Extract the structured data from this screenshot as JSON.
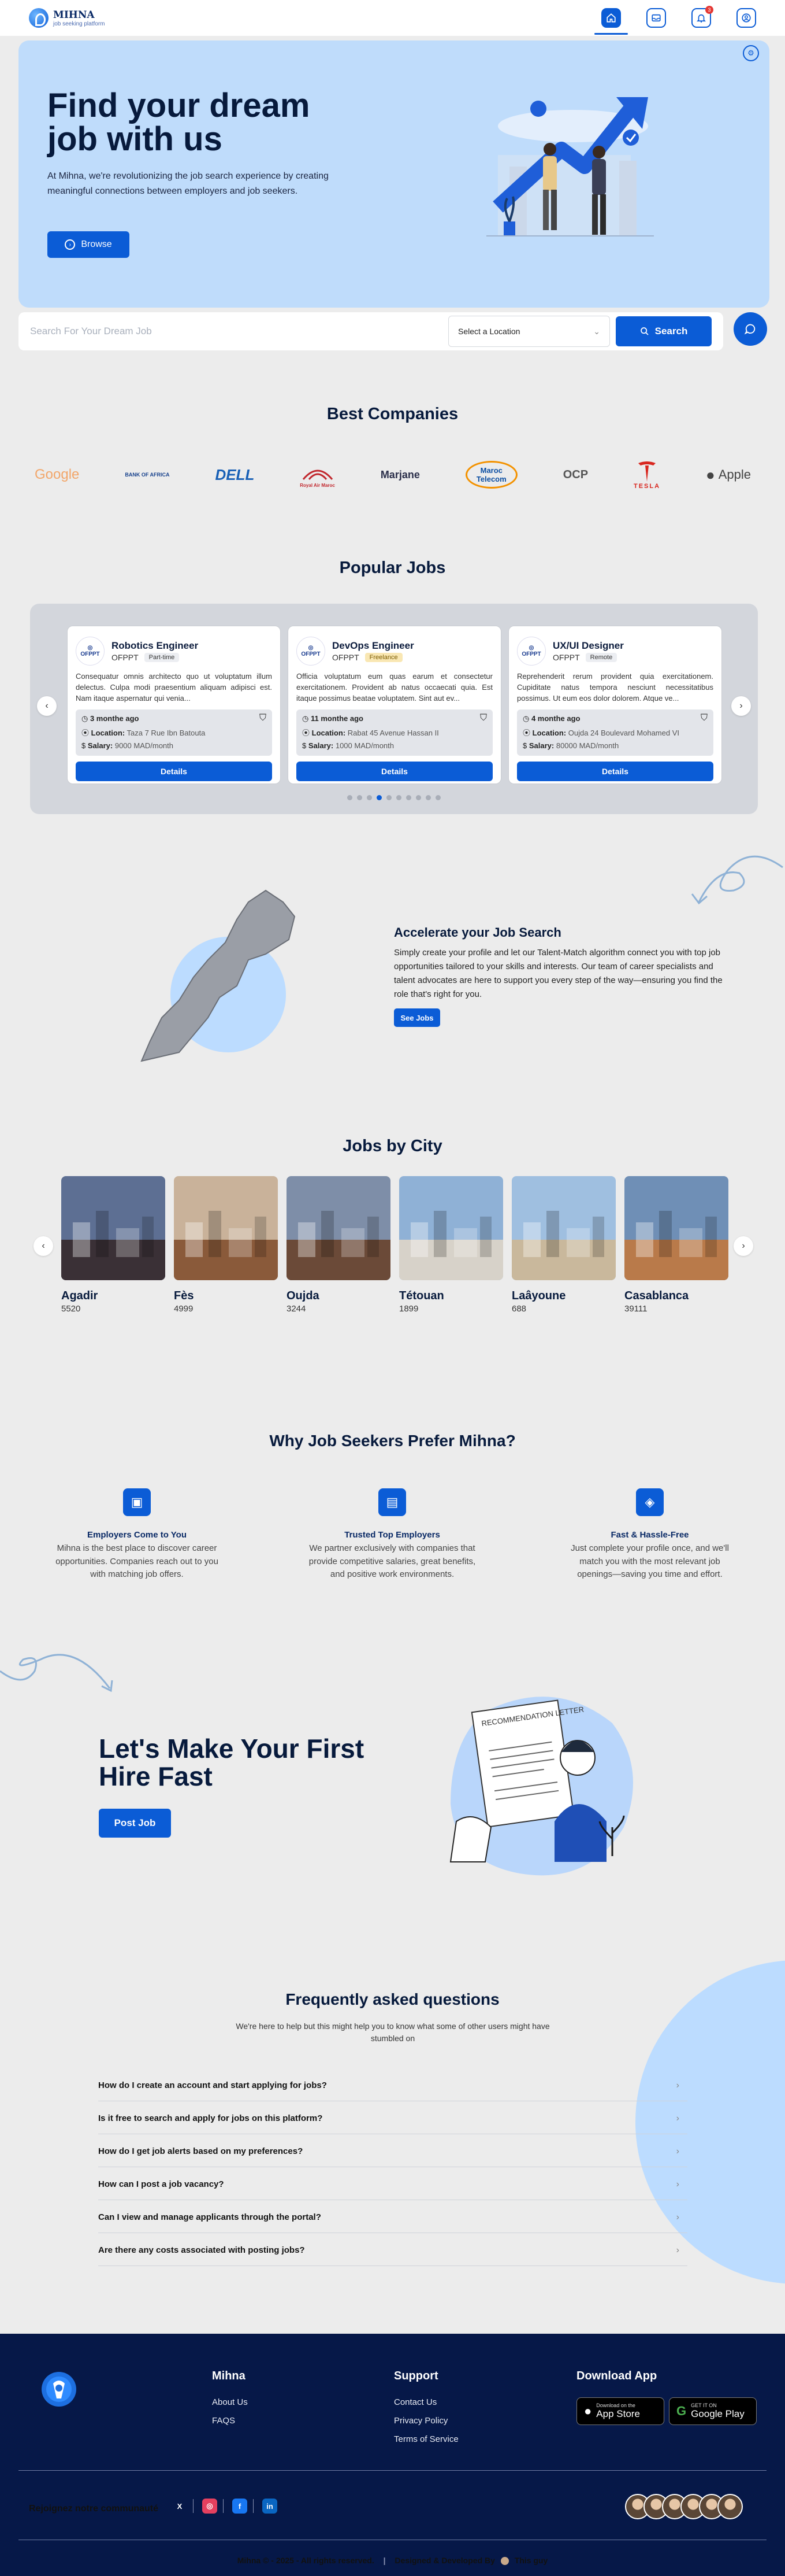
{
  "header": {
    "logo_name": "MIHNA",
    "logo_tagline": "job seeking platform",
    "notification_count": "3"
  },
  "hero": {
    "title": "Find your dream job with us",
    "description": "At Mihna, we're revolutionizing the job search experience by creating meaningful connections between employers and job seekers.",
    "browse_label": "Browse"
  },
  "search": {
    "placeholder": "Search For Your Dream Job",
    "location_label": "Select a Location",
    "button_label": "Search"
  },
  "companies": {
    "title": "Best Companies",
    "items": [
      "Google",
      "Bank of Africa",
      "DELL",
      "Royal Air Maroc",
      "Marjane",
      "Maroc Telecom",
      "OCP",
      "TESLA",
      "Apple"
    ]
  },
  "jobs": {
    "title": "Popular Jobs",
    "location_label": "Location:",
    "salary_label": "Salary:",
    "details_label": "Details",
    "cards": [
      {
        "title": "Robotics Engineer",
        "company": "OFPPT",
        "type": "Part-time",
        "description": "Consequatur omnis architecto quo ut voluptatum illum delectus. Culpa modi praesentium aliquam adipisci est. Nam itaque aspernatur qui venia...",
        "posted": "3 monthe ago",
        "location": "Taza 7 Rue Ibn Batouta",
        "salary": "9000 MAD/month"
      },
      {
        "title": "DevOps Engineer",
        "company": "OFPPT",
        "type": "Freelance",
        "description": "Officia voluptatum eum quas earum et consectetur exercitationem. Provident ab natus occaecati quia. Est itaque possimus beatae voluptatem. Sint aut ev...",
        "posted": "11 monthe ago",
        "location": "Rabat 45 Avenue Hassan II",
        "salary": "1000 MAD/month"
      },
      {
        "title": "UX/UI Designer",
        "company": "OFPPT",
        "type": "Remote",
        "description": "Reprehenderit rerum provident quia exercitationem. Cupiditate natus tempora nesciunt necessitatibus possimus. Ut eum eos dolor dolorem. Atque ve...",
        "posted": "4 monthe ago",
        "location": "Oujda 24 Boulevard Mohamed VI",
        "salary": "80000 MAD/month"
      }
    ],
    "active_dot": 3,
    "dot_count": 10
  },
  "accelerate": {
    "title": "Accelerate your Job Search",
    "text": "Simply create your profile and let our Talent-Match algorithm connect you with top job opportunities tailored to your skills and interests. Our team of career specialists and talent advocates are here to support you every step of the way—ensuring you find the role that's right for you.",
    "button_label": "See Jobs"
  },
  "cities": {
    "title": "Jobs by City",
    "items": [
      {
        "name": "Agadir",
        "count": "5520",
        "sky": "#5d6f93",
        "ground": "#3a3036"
      },
      {
        "name": "Fès",
        "count": "4999",
        "sky": "#c9b29a",
        "ground": "#8a5a3a"
      },
      {
        "name": "Oujda",
        "count": "3244",
        "sky": "#7e8ea8",
        "ground": "#6b4a38"
      },
      {
        "name": "Tétouan",
        "count": "1899",
        "sky": "#8fb1d6",
        "ground": "#d7d2c9"
      },
      {
        "name": "Laâyoune",
        "count": "688",
        "sky": "#9fbfe0",
        "ground": "#c9b89c"
      },
      {
        "name": "Casablanca",
        "count": "39111",
        "sky": "#6f8fb6",
        "ground": "#b97a4a"
      }
    ]
  },
  "why": {
    "title": "Why Job Seekers Prefer Mihna?",
    "items": [
      {
        "title": "Employers Come to You",
        "text": "Mihna is the best place to discover career opportunities. Companies reach out to you with matching job offers.",
        "icon": "briefcase-icon"
      },
      {
        "title": "Trusted Top Employers",
        "text": "We partner exclusively with companies that provide competitive salaries, great benefits, and positive work environments.",
        "icon": "document-icon"
      },
      {
        "title": "Fast & Hassle-Free",
        "text": "Just complete your profile once, and we'll match you with the most relevant job openings—saving you time and effort.",
        "icon": "layers-icon"
      }
    ]
  },
  "post": {
    "title": "Let's Make Your First Hire Fast",
    "button_label": "Post Job",
    "letter_heading": "RECOMMENDATION LETTER"
  },
  "faq": {
    "title": "Frequently asked questions",
    "subtitle": "We're here to help but this might help you to know what some of other users might have stumbled on",
    "items": [
      "How do I create an account and start applying for jobs?",
      "Is it free to search and apply for jobs on this platform?",
      "How do I get job alerts based on my preferences?",
      "How can I post a job vacancy?",
      "Can I view and manage applicants through the portal?",
      "Are there any costs associated with posting jobs?"
    ]
  },
  "footer": {
    "col1_title": "Mihna",
    "col1_links": [
      "About Us",
      "FAQS"
    ],
    "col2_title": "Support",
    "col2_links": [
      "Contact Us",
      "Privacy Policy",
      "Terms of Service"
    ],
    "col3_title": "Download App",
    "app_store_small": "Download on the",
    "app_store_big": "App Store",
    "play_small": "GET IT ON",
    "play_big": "Google Play",
    "community_label": "Rejoignez notre communauté",
    "copyright": "Mihna © - 2025 - All rights reserved.",
    "designed_by": "Designed & Developed By",
    "designer": "This guy"
  }
}
